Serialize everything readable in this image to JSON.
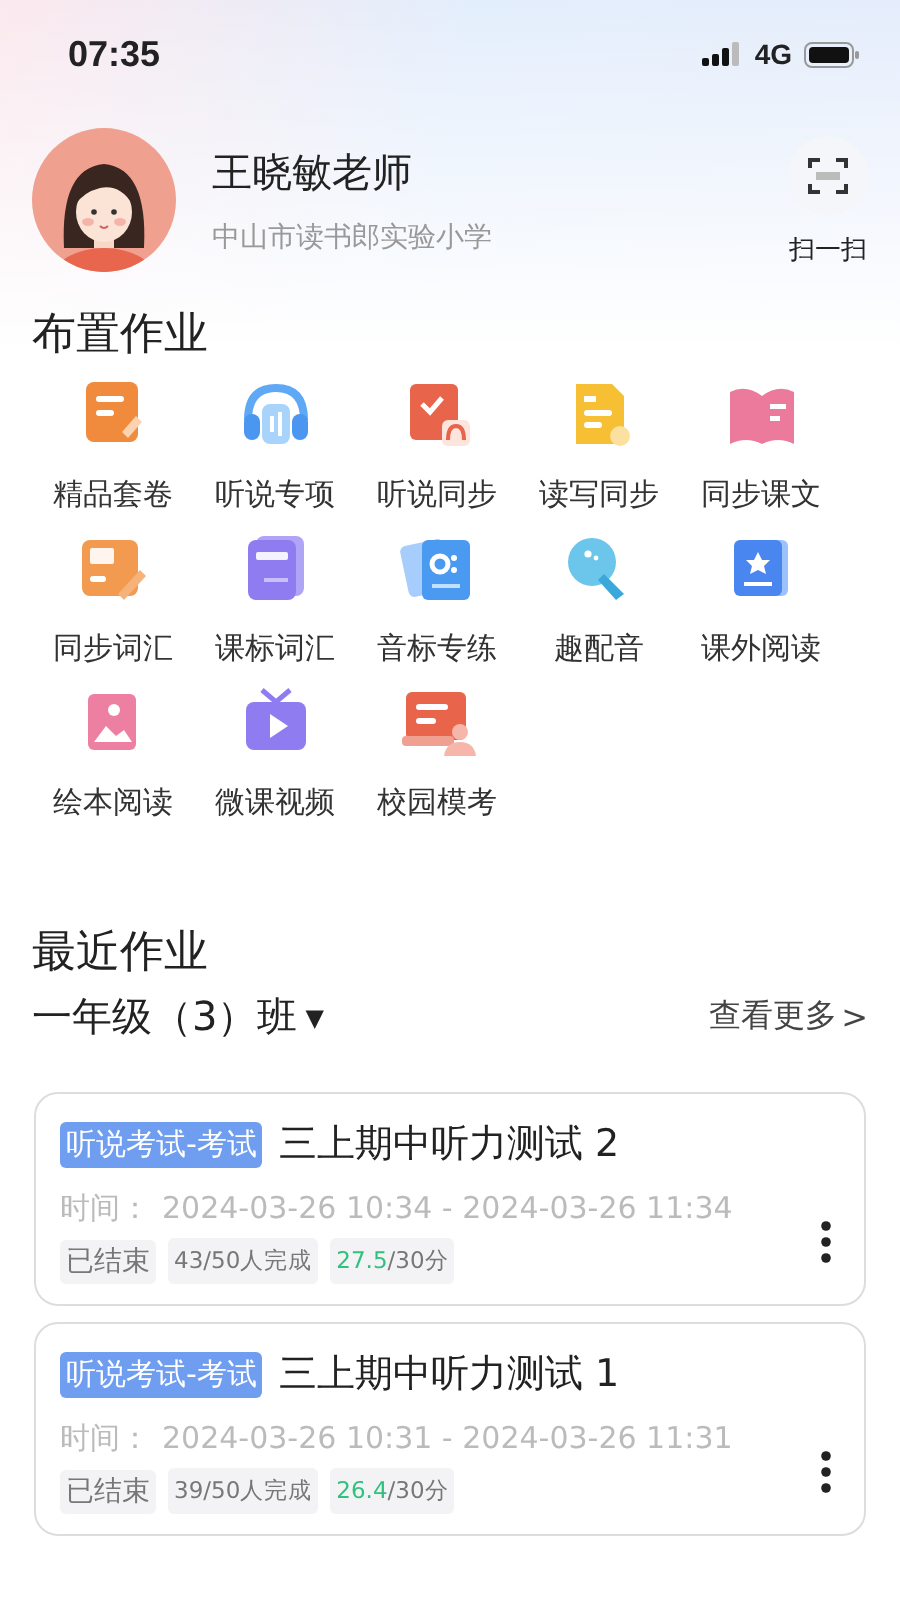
{
  "status_bar": {
    "time": "07:35",
    "network": "4G"
  },
  "profile": {
    "name": "王晓敏老师",
    "school": "中山市读书郎实验小学",
    "scan_label": "扫一扫"
  },
  "assign": {
    "title": "布置作业",
    "items": [
      {
        "label": "精品套卷",
        "kind": "paper"
      },
      {
        "label": "听说专项",
        "kind": "headphones"
      },
      {
        "label": "听说同步",
        "kind": "listen-sync"
      },
      {
        "label": "读写同步",
        "kind": "write"
      },
      {
        "label": "同步课文",
        "kind": "book"
      },
      {
        "label": "同步词汇",
        "kind": "vocab"
      },
      {
        "label": "课标词汇",
        "kind": "word"
      },
      {
        "label": "音标专练",
        "kind": "phonetic"
      },
      {
        "label": "趣配音",
        "kind": "dubbing"
      },
      {
        "label": "课外阅读",
        "kind": "reading"
      },
      {
        "label": "绘本阅读",
        "kind": "picture"
      },
      {
        "label": "微课视频",
        "kind": "video"
      },
      {
        "label": "校园模考",
        "kind": "exam"
      }
    ]
  },
  "recent": {
    "title": "最近作业",
    "class_name": "一年级（3）班",
    "dropdown": "▼",
    "more": "查看更多",
    "more_arrow": ">",
    "cards": [
      {
        "tag": "听说考试-考试",
        "title": "三上期中听力测试 2",
        "time_label": "时间：",
        "time": "2024-03-26 10:34 - 2024-03-26 11:34",
        "status": "已结束",
        "completion": "43/50人完成",
        "score_value": "27.5",
        "score_total": "/30分"
      },
      {
        "tag": "听说考试-考试",
        "title": "三上期中听力测试 1",
        "time_label": "时间：",
        "time": "2024-03-26 10:31 - 2024-03-26 11:31",
        "status": "已结束",
        "completion": "39/50人完成",
        "score_value": "26.4",
        "score_total": "/30分"
      }
    ]
  }
}
